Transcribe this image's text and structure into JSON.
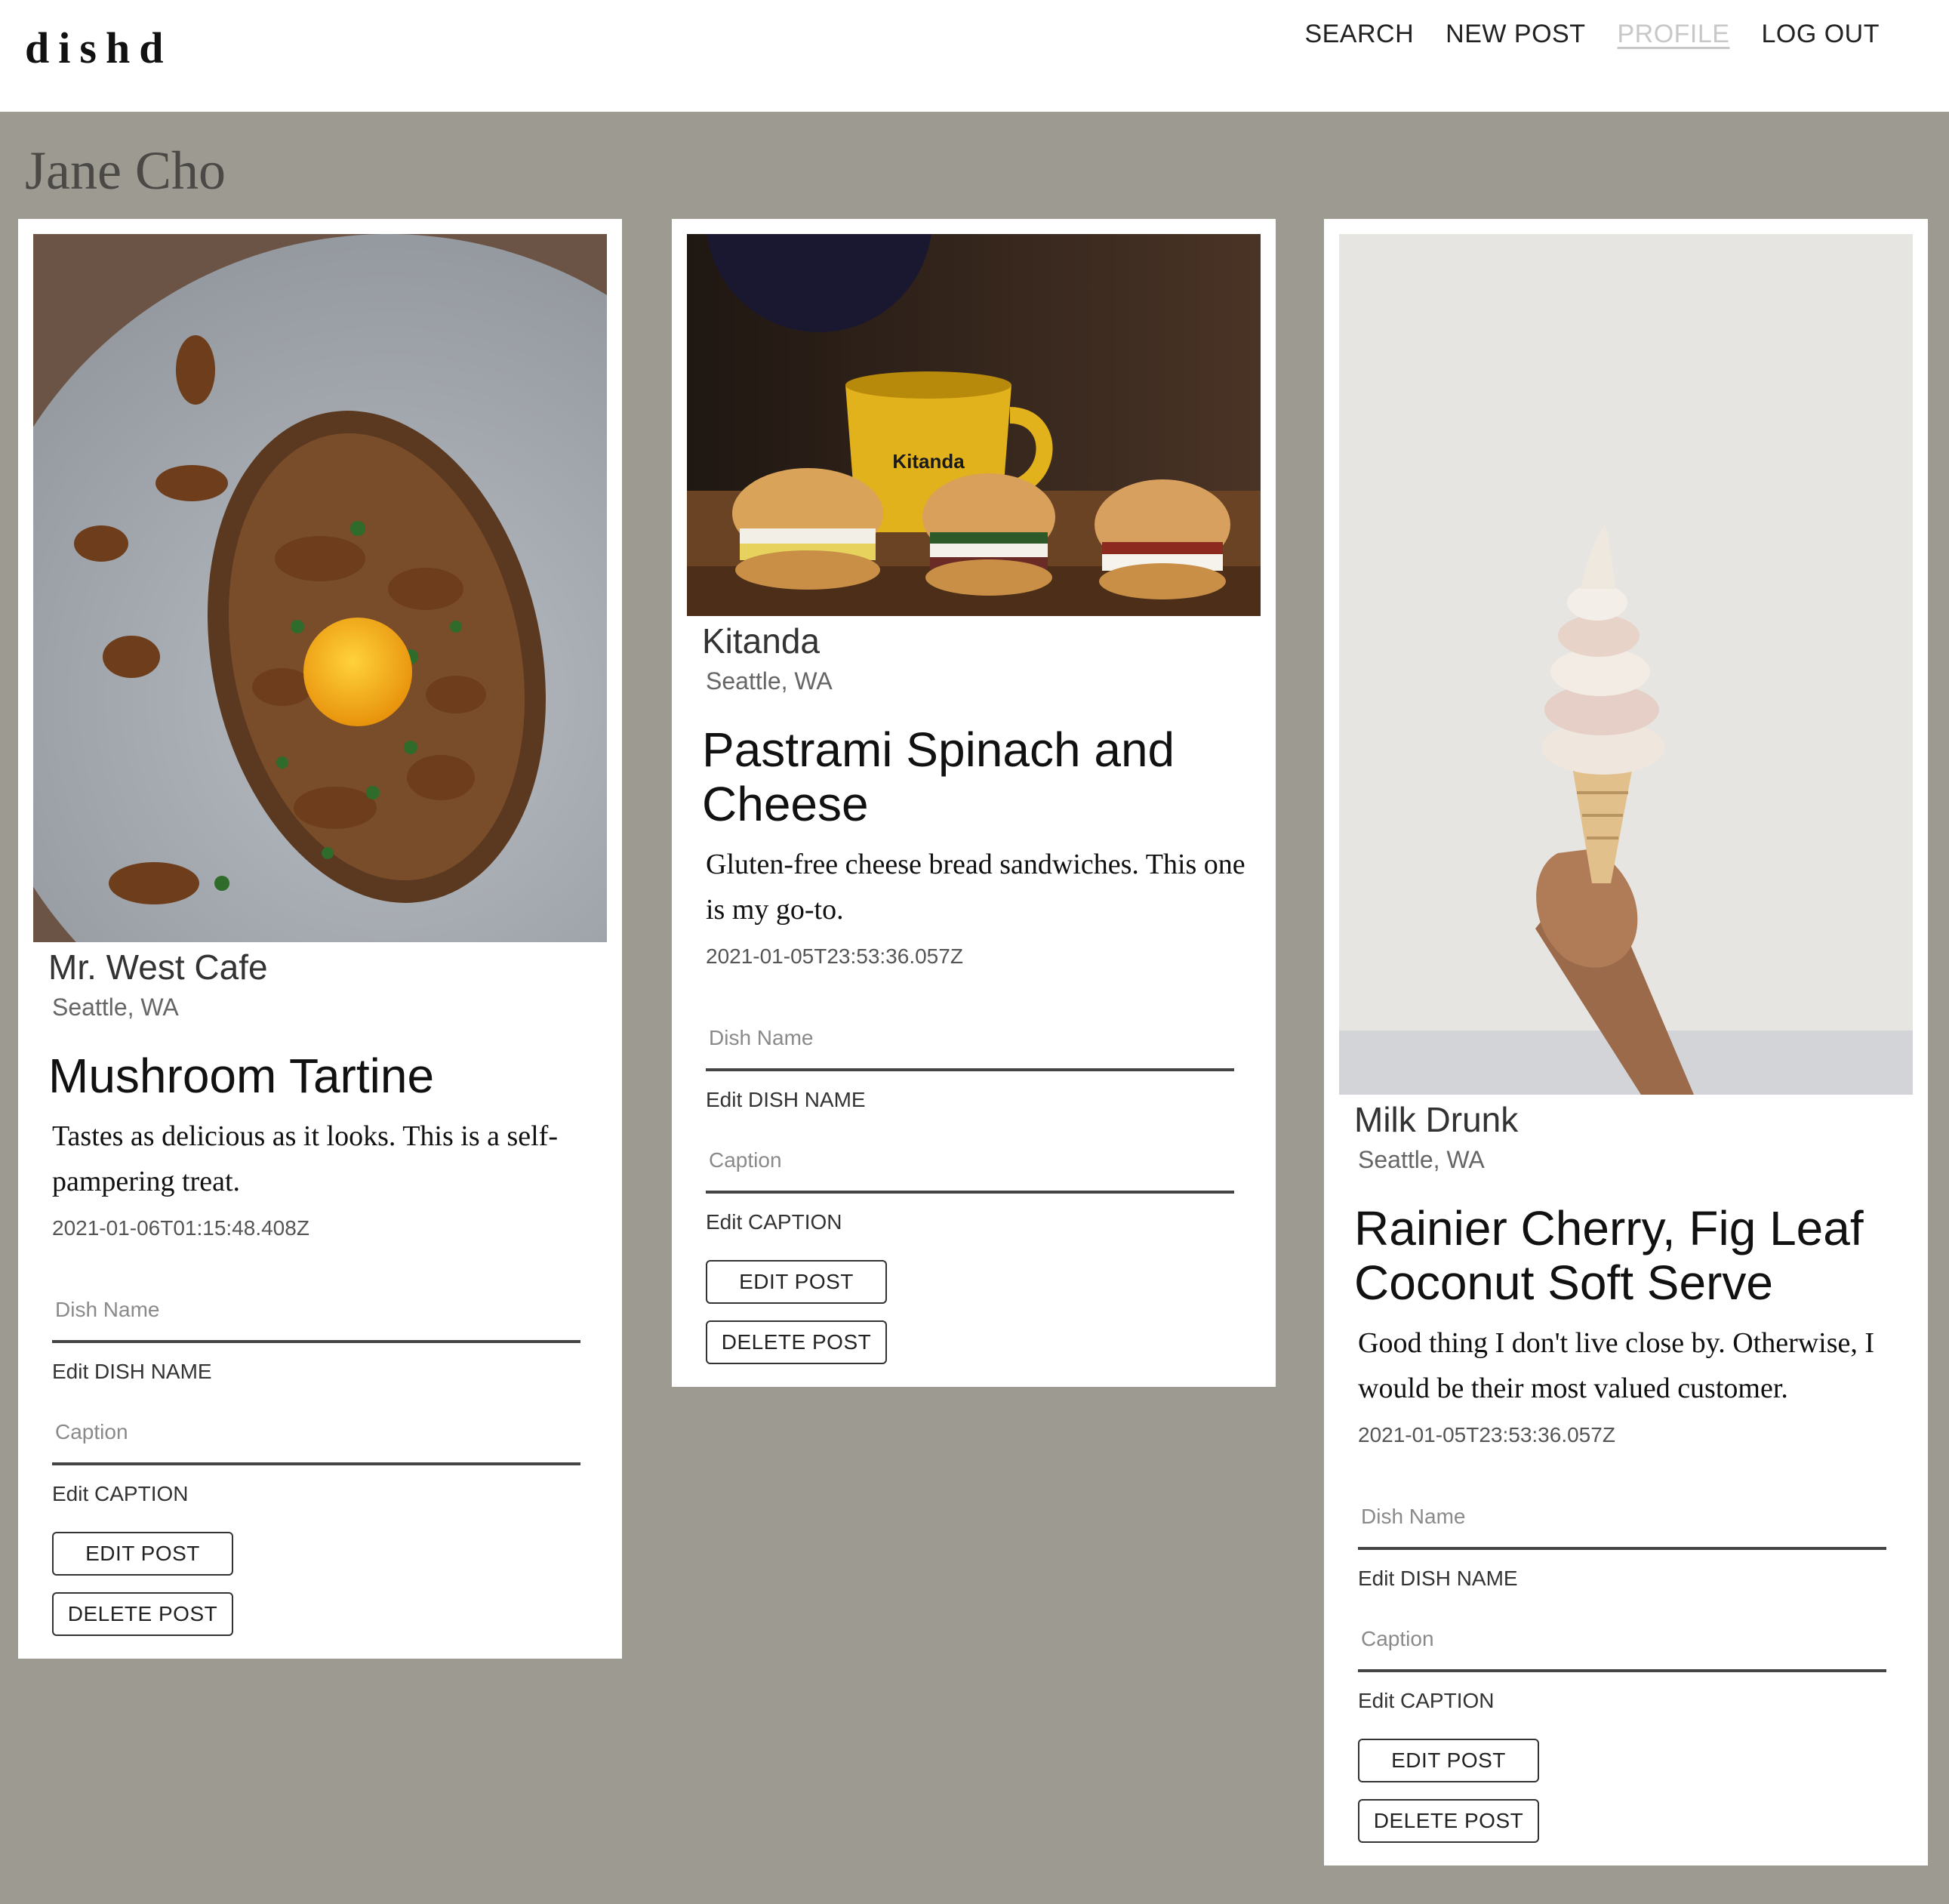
{
  "app": {
    "logo": "dishd"
  },
  "nav": [
    {
      "label": "SEARCH",
      "active": false
    },
    {
      "label": "NEW POST",
      "active": false
    },
    {
      "label": "PROFILE",
      "active": true
    },
    {
      "label": "LOG OUT",
      "active": false
    }
  ],
  "profile": {
    "name": "Jane Cho"
  },
  "posts": [
    {
      "restaurant": "Mr. West Cafe",
      "location": "Seattle, WA",
      "dish": "Mushroom Tartine",
      "caption": "Tastes as delicious as it looks. This is a self-pampering treat.",
      "timestamp": "2021-01-06T01:15:48.408Z",
      "photo": "mushroom-tartine-photo",
      "dish_placeholder": "Dish Name",
      "dish_helper": "Edit DISH NAME",
      "caption_placeholder": "Caption",
      "caption_helper": "Edit CAPTION",
      "edit_label": "EDIT POST",
      "delete_label": "DELETE POST"
    },
    {
      "restaurant": "Kitanda",
      "location": "Seattle, WA",
      "dish": "Pastrami Spinach and Cheese",
      "caption": "Gluten-free cheese bread sandwiches. This one is my go-to.",
      "timestamp": "2021-01-05T23:53:36.057Z",
      "photo": "cheese-bread-sandwiches-photo",
      "mug_text": "Kitanda",
      "dish_placeholder": "Dish Name",
      "dish_helper": "Edit DISH NAME",
      "caption_placeholder": "Caption",
      "caption_helper": "Edit CAPTION",
      "edit_label": "EDIT POST",
      "delete_label": "DELETE POST"
    },
    {
      "restaurant": "Milk Drunk",
      "location": "Seattle, WA",
      "dish": "Rainier Cherry, Fig Leaf Coconut Soft Serve",
      "caption": "Good thing I don't live close by. Otherwise, I would be their most valued customer.",
      "timestamp": "2021-01-05T23:53:36.057Z",
      "photo": "soft-serve-cone-photo",
      "dish_placeholder": "Dish Name",
      "dish_helper": "Edit DISH NAME",
      "caption_placeholder": "Caption",
      "caption_helper": "Edit CAPTION",
      "edit_label": "EDIT POST",
      "delete_label": "DELETE POST"
    }
  ],
  "colors": {
    "background": "#9d9a92",
    "card": "#ffffff",
    "active_nav": "#c8c8c8"
  }
}
